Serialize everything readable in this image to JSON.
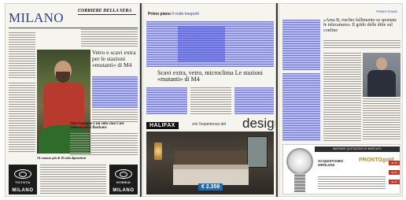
{
  "pages": [
    {
      "masthead": "MILANO",
      "newspaper": "CORRIERE DELLA SERA",
      "headlines": {
        "main": "Vetro e scavi extra per le stazioni «mutanti» di M4",
        "bottom": "Otto famiglie e un solo ciao Così comandano i Barbaro",
        "footer_strip": "Al comune più di 10 mila dipendenti"
      },
      "ad": {
        "brand": "TOYOTA",
        "city": "MILANO",
        "brand_right": "HYBRID"
      }
    },
    {
      "section_label": "Primo piano",
      "section_sub": "Il nodo trasporti",
      "headline": "Scavi extra, vetro, microclima Le stazioni «mutanti» di M4",
      "ad": {
        "logo": "HALIFAX",
        "tagline": "vivi l'esperienza del",
        "design_word": "design",
        "price": "€ 2.359"
      }
    },
    {
      "section_label": "PRIMO PIANO",
      "headline": "«Area B, rischio fallimento se spostate le telecamere» Il grido delle ditte sul confine",
      "ad": {
        "header": "MASSIME QUOTAZIONI DI MERCATO",
        "acquisto": "ACQUISTIAMO OROLOGI",
        "brand": "PRONTOgold",
        "prices": [
          "34,70",
          "34,70",
          "34,70"
        ]
      }
    }
  ],
  "colors": {
    "masthead_blue": "#2b3f8f",
    "annotation_blue": "#5060dc",
    "ad_black": "#1b1b1b",
    "price_blue": "#1c6bb0",
    "gold": "#b7892a"
  }
}
